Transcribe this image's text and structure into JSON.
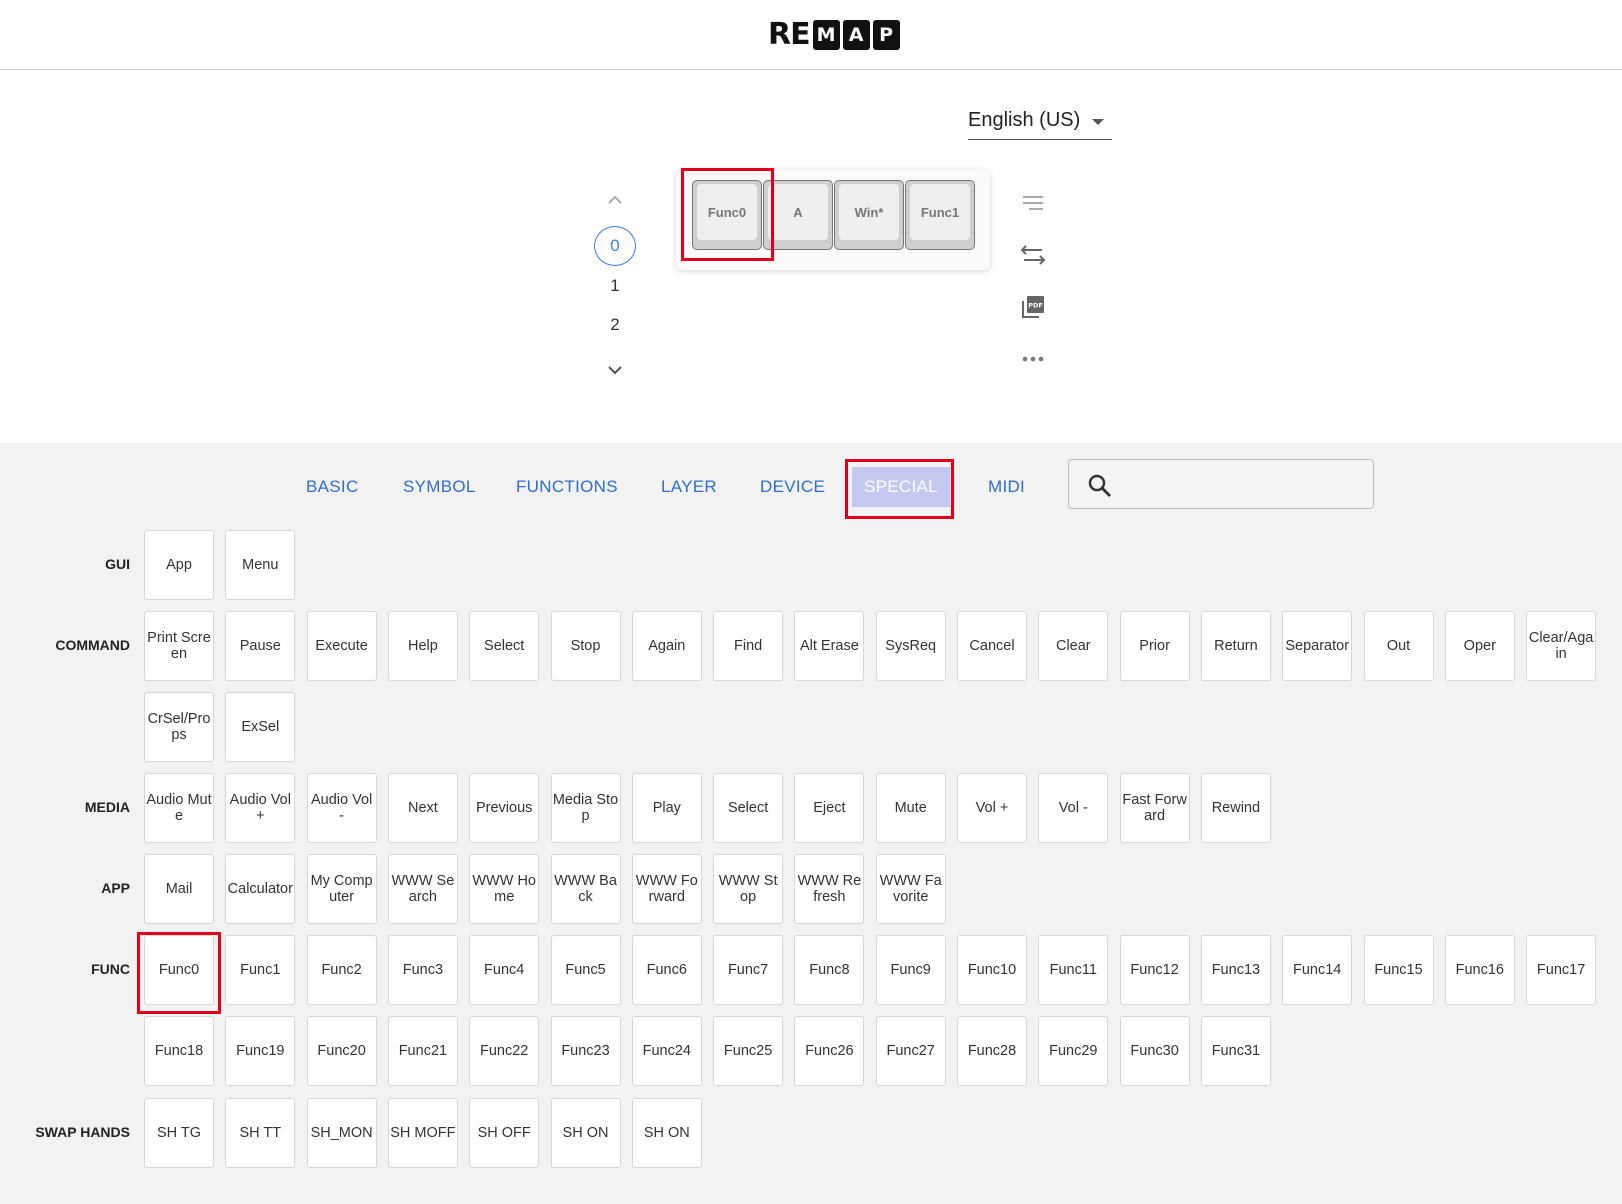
{
  "header": {
    "logo_plain": "RE",
    "logo_boxed": [
      "M",
      "A",
      "P"
    ]
  },
  "language": {
    "selected": "English (US)"
  },
  "layers": {
    "items": [
      "0",
      "1",
      "2"
    ],
    "active": "0"
  },
  "keyboard": {
    "keys": [
      "Func0",
      "A",
      "Win*",
      "Func1"
    ]
  },
  "side_tools": [
    "menu-lines-icon",
    "swap-icon",
    "pdf-icon",
    "more-icon"
  ],
  "tabs": [
    {
      "label": "BASIC"
    },
    {
      "label": "SYMBOL"
    },
    {
      "label": "FUNCTIONS"
    },
    {
      "label": "LAYER"
    },
    {
      "label": "DEVICE"
    },
    {
      "label": "SPECIAL",
      "active": true
    },
    {
      "label": "MIDI"
    }
  ],
  "search": {
    "placeholder": "",
    "value": ""
  },
  "groups": [
    {
      "label": "GUI",
      "keys": [
        "App",
        "Menu"
      ]
    },
    {
      "label": "COMMAND",
      "keys": [
        "Print Screen",
        "Pause",
        "Execute",
        "Help",
        "Select",
        "Stop",
        "Again",
        "Find",
        "Alt Erase",
        "SysReq",
        "Cancel",
        "Clear",
        "Prior",
        "Return",
        "Separator",
        "Out",
        "Oper",
        "Clear/Again",
        "CrSel/Props",
        "ExSel"
      ]
    },
    {
      "label": "MEDIA",
      "keys": [
        "Audio Mute",
        "Audio Vol +",
        "Audio Vol -",
        "Next",
        "Previous",
        "Media Stop",
        "Play",
        "Select",
        "Eject",
        "Mute",
        "Vol +",
        "Vol -",
        "Fast Forward",
        "Rewind"
      ]
    },
    {
      "label": "APP",
      "keys": [
        "Mail",
        "Calculator",
        "My Computer",
        "WWW Search",
        "WWW Home",
        "WWW Back",
        "WWW Forward",
        "WWW Stop",
        "WWW Refresh",
        "WWW Favorite"
      ]
    },
    {
      "label": "FUNC",
      "keys": [
        "Func0",
        "Func1",
        "Func2",
        "Func3",
        "Func4",
        "Func5",
        "Func6",
        "Func7",
        "Func8",
        "Func9",
        "Func10",
        "Func11",
        "Func12",
        "Func13",
        "Func14",
        "Func15",
        "Func16",
        "Func17",
        "Func18",
        "Func19",
        "Func20",
        "Func21",
        "Func22",
        "Func23",
        "Func24",
        "Func25",
        "Func26",
        "Func27",
        "Func28",
        "Func29",
        "Func30",
        "Func31"
      ]
    },
    {
      "label": "SWAP HANDS",
      "keys": [
        "SH TG",
        "SH TT",
        "SH_MON",
        "SH MOFF",
        "SH OFF",
        "SH ON",
        "SH ON"
      ]
    }
  ],
  "colors": {
    "accent": "#3d7be6",
    "highlight": "#e0001a",
    "active_tab_bg": "#c5c8ef"
  }
}
